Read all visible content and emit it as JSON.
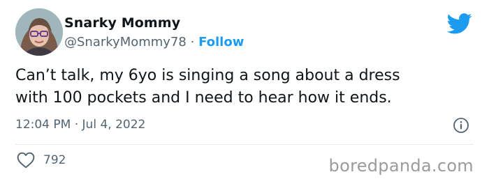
{
  "author": {
    "display_name": "Snarky Mommy",
    "handle": "@SnarkyMommy78",
    "separator": "·",
    "follow_label": "Follow"
  },
  "tweet": {
    "text_line1": "Can’t talk, my 6yo is singing a song about a dress",
    "text_line2": "with 100 pockets and I need to hear how it ends.",
    "timestamp": "12:04 PM · Jul 4, 2022"
  },
  "actions": {
    "like_count": "792"
  },
  "watermark": "boredpanda.com",
  "colors": {
    "accent": "#1d9bf0",
    "text": "#0f1419",
    "muted": "#536471",
    "divider": "#e6ecf0"
  },
  "icons": [
    "avatar-photo",
    "twitter-bird-icon",
    "info-icon",
    "heart-icon"
  ]
}
